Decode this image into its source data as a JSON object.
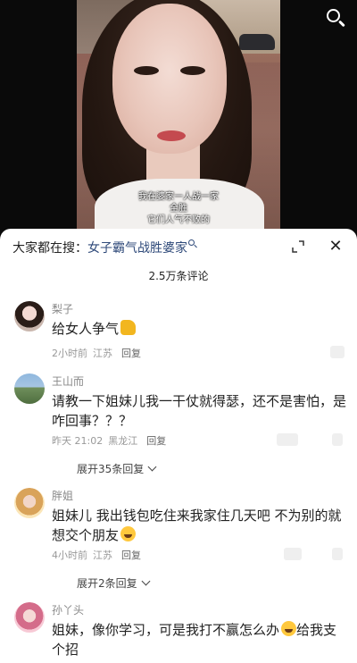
{
  "video": {
    "subtitle_line1": "我在婆家一人战一家",
    "subtitle_line2": "全胜",
    "subtitle_line3": "它们人气不败的"
  },
  "icons": {
    "search": "search-icon",
    "expand": "expand-icon",
    "close": "close-icon"
  },
  "sheet": {
    "search_prefix": "大家都在搜：",
    "search_term": "女子霸气战胜婆家",
    "close_glyph": "✕",
    "comment_count": "2.5万条评论"
  },
  "comments": [
    {
      "username": "梨子",
      "text": "给女人争气",
      "emoji": "thumbs-up",
      "time": "2小时前",
      "location": "江苏",
      "reply_label": "回复"
    },
    {
      "username": "王山而",
      "text": "请教一下姐妹儿我一干仗就得瑟，还不是害怕，是咋回事？？？",
      "time": "昨天 21:02",
      "location": "黑龙江",
      "reply_label": "回复",
      "expand_replies": "展开35条回复"
    },
    {
      "username": "胖姐",
      "text": "姐妹儿 我出钱包吃住来我家住几天吧 不为别的就想交个朋友",
      "emoji": "smile",
      "time": "4小时前",
      "location": "江苏",
      "reply_label": "回复",
      "expand_replies": "展开2条回复"
    },
    {
      "username": "孙丫头",
      "text_part1": "姐妹，像你学习，可是我打不赢怎么办",
      "emoji": "crying",
      "text_part2": "给我支个招"
    }
  ]
}
